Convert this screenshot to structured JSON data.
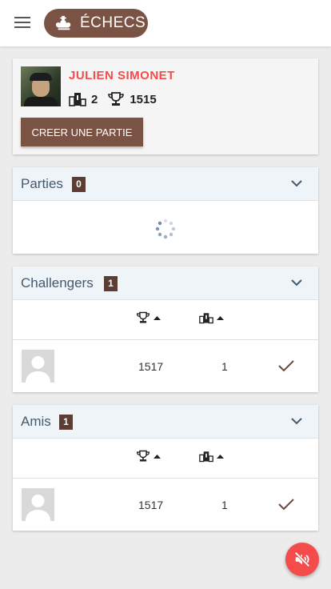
{
  "app": {
    "title": "ÉCHECS",
    "icons": {
      "menu": "menu-icon",
      "logo": "chess-king-icon"
    },
    "accent": "#7b5344",
    "alert": "#f44b4b"
  },
  "profile": {
    "name": "JULIEN SIMONET",
    "rank": "2",
    "elo": "1515",
    "create_button": "CREER UNE PARTIE"
  },
  "parties": {
    "title": "Parties",
    "count": "0",
    "loading": true
  },
  "challengers": {
    "title": "Challengers",
    "count": "1",
    "rows": [
      {
        "elo": "1517",
        "rank": "1"
      }
    ]
  },
  "amis": {
    "title": "Amis",
    "count": "1",
    "rows": [
      {
        "elo": "1517",
        "rank": "1"
      }
    ]
  },
  "sound_button": {
    "icon": "volume-mute-icon",
    "color": "#f44b4b"
  }
}
